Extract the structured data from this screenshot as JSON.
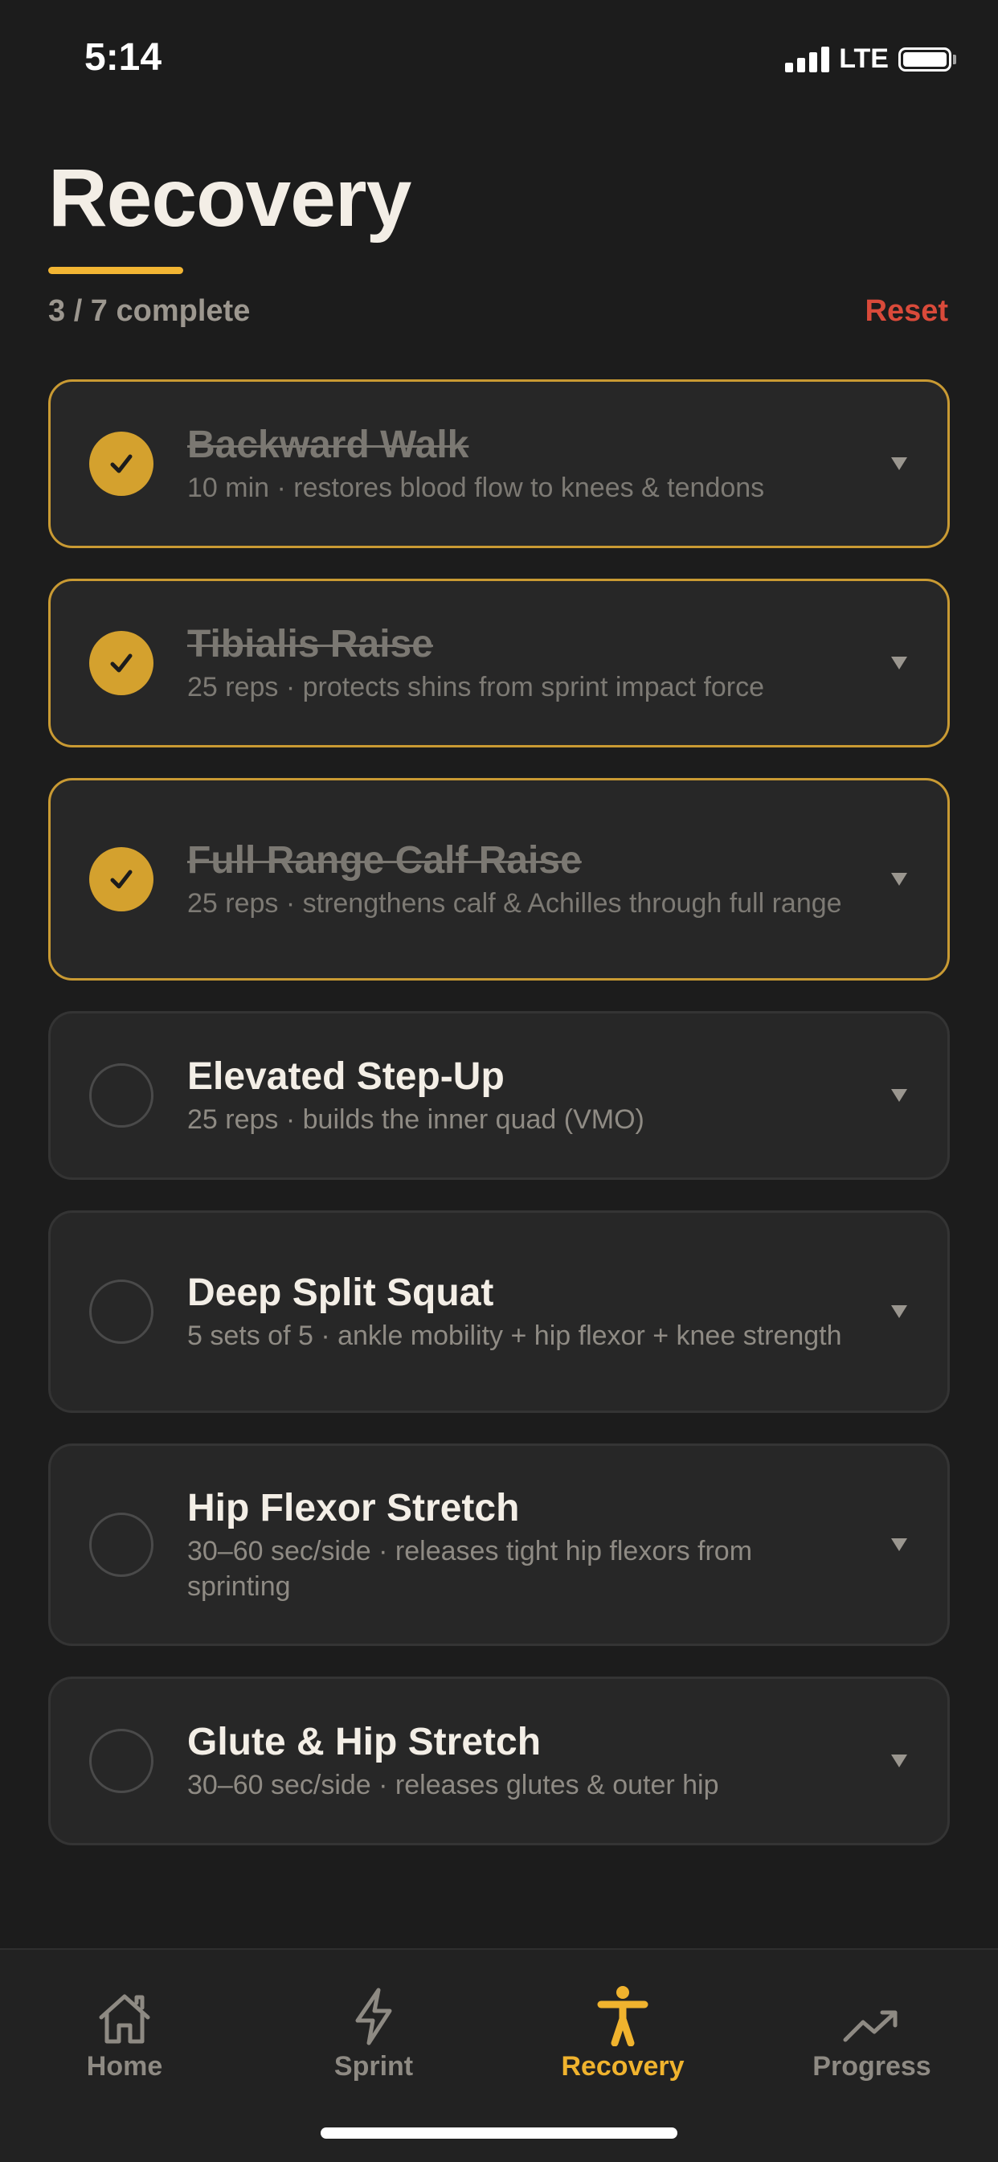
{
  "status_bar": {
    "time": "5:14",
    "network": "LTE"
  },
  "header": {
    "title": "Recovery",
    "progress": "3 / 7 complete",
    "reset_label": "Reset",
    "completed_count": 3,
    "total_count": 7
  },
  "exercises": [
    {
      "title": "Backward Walk",
      "subtitle": "10 min · restores blood flow to knees & tendons",
      "done": true
    },
    {
      "title": "Tibialis Raise",
      "subtitle": "25 reps · protects shins from sprint impact force",
      "done": true
    },
    {
      "title": "Full Range Calf Raise",
      "subtitle": "25 reps · strengthens calf & Achilles through full range",
      "done": true
    },
    {
      "title": "Elevated Step-Up",
      "subtitle": "25 reps · builds the inner quad (VMO)",
      "done": false
    },
    {
      "title": "Deep Split Squat",
      "subtitle": "5 sets of 5 · ankle mobility + hip flexor + knee strength",
      "done": false
    },
    {
      "title": "Hip Flexor Stretch",
      "subtitle": "30–60 sec/side · releases tight hip flexors from sprinting",
      "done": false
    },
    {
      "title": "Glute & Hip Stretch",
      "subtitle": "30–60 sec/side · releases glutes & outer hip",
      "done": false
    }
  ],
  "tabs": [
    {
      "label": "Home",
      "icon": "home-icon",
      "active": false
    },
    {
      "label": "Sprint",
      "icon": "lightning-icon",
      "active": false
    },
    {
      "label": "Recovery",
      "icon": "person-icon",
      "active": true
    },
    {
      "label": "Progress",
      "icon": "trend-up-icon",
      "active": false
    }
  ],
  "colors": {
    "accent": "#f2b533",
    "done_border": "#c99a33",
    "reset": "#d94a3a",
    "background": "#1c1c1c",
    "card": "#272727"
  }
}
